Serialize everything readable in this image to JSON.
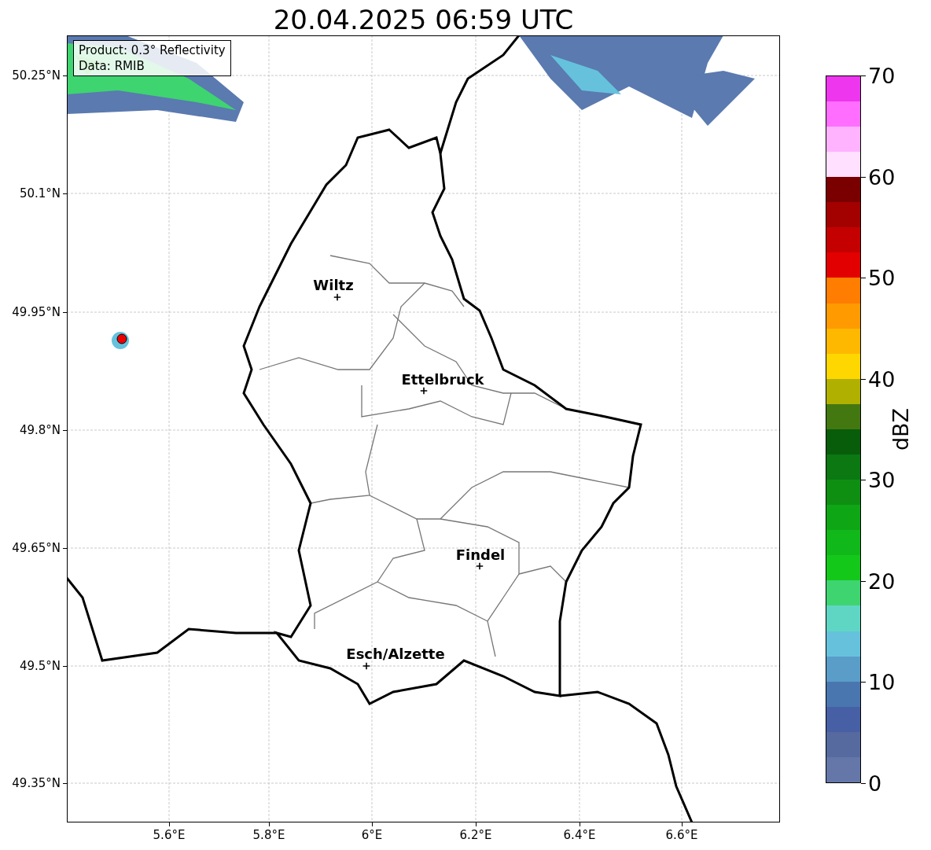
{
  "title": "20.04.2025 06:59 UTC",
  "info": [
    "Product: 0.3° Reflectivity",
    "Data: RMIB"
  ],
  "map": {
    "cities": [
      {
        "name": "Wiltz"
      },
      {
        "name": "Ettelbruck"
      },
      {
        "name": "Findel"
      },
      {
        "name": "Esch/Alzette"
      }
    ],
    "xticks": [
      "5.6°E",
      "5.8°E",
      "6°E",
      "6.2°E",
      "6.4°E",
      "6.6°E"
    ],
    "yticks": [
      "50.25°N",
      "50.1°N",
      "49.95°N",
      "49.8°N",
      "49.65°N",
      "49.5°N",
      "49.35°N"
    ]
  },
  "colorbar": {
    "label": "dBZ",
    "ticks": [
      "70",
      "60",
      "50",
      "40",
      "30",
      "20",
      "10",
      "0"
    ],
    "bands": [
      {
        "color": "#6577a8"
      },
      {
        "color": "#566aa0"
      },
      {
        "color": "#4760a5"
      },
      {
        "color": "#4a76b0"
      },
      {
        "color": "#5a9dc8"
      },
      {
        "color": "#66c2dc"
      },
      {
        "color": "#5fd6c4"
      },
      {
        "color": "#3ed470"
      },
      {
        "color": "#14c81a"
      },
      {
        "color": "#10b819"
      },
      {
        "color": "#0fa615"
      },
      {
        "color": "#0e8f12"
      },
      {
        "color": "#0b7812"
      },
      {
        "color": "#085d0a"
      },
      {
        "color": "#437811"
      },
      {
        "color": "#b0b000"
      },
      {
        "color": "#ffd700"
      },
      {
        "color": "#ffb800"
      },
      {
        "color": "#ff9a00"
      },
      {
        "color": "#ff7d00"
      },
      {
        "color": "#e30000"
      },
      {
        "color": "#c40000"
      },
      {
        "color": "#a30000"
      },
      {
        "color": "#7a0000"
      },
      {
        "color": "#ffe0ff"
      },
      {
        "color": "#ffb3ff"
      },
      {
        "color": "#ff6eff"
      },
      {
        "color": "#ee36ee"
      }
    ]
  }
}
